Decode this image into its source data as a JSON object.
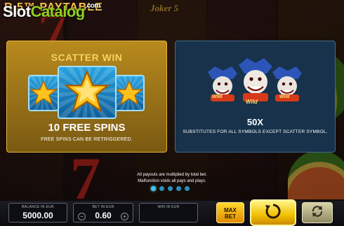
{
  "header": {
    "paytable_title": "R 5™ PAYTABLE",
    "logo_slot": "Slot",
    "logo_catalog": "Catalog",
    "logo_com": ".com",
    "reel_title": "Joker 5"
  },
  "scatter_panel": {
    "title": "SCATTER WIN",
    "free_spins": "10 FREE SPINS",
    "note": "FREE SPINS CAN BE RETRIGGERED.",
    "icon": "star-icon"
  },
  "wild_panel": {
    "multiplier": "50X",
    "description": "SUBSTITUTES FOR ALL SYMBOLS EXCEPT SCATTER SYMBOL.",
    "symbol_label": "Wild",
    "icon": "joker-wild-icon"
  },
  "footnotes": {
    "line1": "All payouts are multiplied by total bet.",
    "line2": "Malfunction voids all pays and plays."
  },
  "pagination": {
    "pages": 5,
    "active_page": 1
  },
  "balance": {
    "label": "BALANCE IN EUR",
    "value": "5000.00"
  },
  "bet": {
    "label": "BET IN EUR",
    "value": "0.60",
    "minus": "−",
    "plus": "+"
  },
  "win": {
    "label": "WIN IN EUR",
    "value": ""
  },
  "controls": {
    "max_bet_line1": "MAX",
    "max_bet_line2": "BET",
    "spin_icon": "spin-icon",
    "autoplay_icon": "autoplay-icon"
  },
  "colors": {
    "gold": "#f4d35e",
    "panel_blue": "#17324a",
    "accent_yellow": "#f2c100"
  }
}
